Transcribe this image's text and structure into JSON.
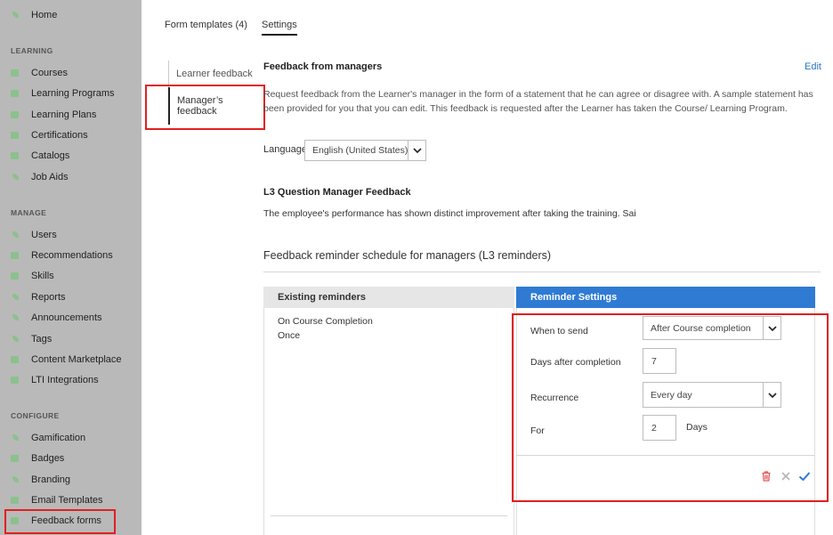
{
  "sidebar": {
    "top": {
      "label": "Home",
      "icon": "home-icon"
    },
    "sections": [
      {
        "header": "LEARNING",
        "items": [
          "Courses",
          "Learning Programs",
          "Learning Plans",
          "Certifications",
          "Catalogs",
          "Job Aids"
        ]
      },
      {
        "header": "MANAGE",
        "items": [
          "Users",
          "Recommendations",
          "Skills",
          "Reports",
          "Announcements",
          "Tags",
          "Content Marketplace",
          "LTI Integrations"
        ]
      },
      {
        "header": "CONFIGURE",
        "items": [
          "Gamification",
          "Badges",
          "Branding",
          "Email Templates",
          "Feedback forms"
        ]
      }
    ]
  },
  "tabs": {
    "form_templates": "Form templates (4)",
    "settings": "Settings"
  },
  "subnav": {
    "learner": "Learner feedback",
    "manager": "Manager’s feedback"
  },
  "main": {
    "title": "Feedback from managers",
    "edit": "Edit",
    "description": "Request feedback from the Learner's manager in the form of a statement that he can agree or disagree with. A sample statement has been provided for you that you can edit. This feedback is requested after the Learner has taken the Course/ Learning Program.",
    "language_label": "Language",
    "language_value": "English (United States)",
    "question_title": "L3 Question Manager Feedback",
    "question_text": "The employee's performance has shown distinct improvement after taking the training. Sai",
    "schedule_title": "Feedback reminder schedule for managers (L3 reminders)"
  },
  "reminders": {
    "existing_header": "Existing reminders",
    "existing_items": [
      "On Course Completion",
      "Once"
    ],
    "settings_header": "Reminder Settings",
    "when_label": "When to send",
    "when_value": "After Course completion",
    "days_label": "Days after completion",
    "days_value": "7",
    "recurrence_label": "Recurrence",
    "recurrence_value": "Every day",
    "for_label": "For",
    "for_value": "2",
    "for_unit": "Days"
  },
  "colors": {
    "accent": "#2f7ad3",
    "sidebar_bg": "#b9b9b9",
    "highlight": "#e02020",
    "delete": "#e05a5a",
    "confirm": "#2f7ad3"
  }
}
